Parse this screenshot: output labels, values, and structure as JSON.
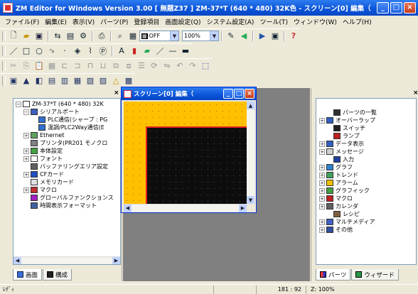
{
  "window": {
    "title": "ZM Editor for Windows Version 3.00 [ 無題Z37 ] ZM-37*T (640 * 480) 32K色 - スクリーン[0] 編集（　... ",
    "min": "_",
    "max": "□",
    "close": "×"
  },
  "menu": [
    "ファイル(F)",
    "編集(E)",
    "表示(V)",
    "パーツ(P)",
    "登録項目",
    "画面設定(Q)",
    "システム設定(A)",
    "ツール(T)",
    "ウィンドウ(W)",
    "ヘルプ(H)"
  ],
  "toolbar": {
    "grid_combo": "OFF",
    "zoom_combo": "100%"
  },
  "left_panel": {
    "close": "×",
    "tree": [
      {
        "label": "ZM-37*T (640 * 480) 32K",
        "exp": "⊟",
        "depth": 0,
        "color": "#ffffff"
      },
      {
        "label": "シリアルポート",
        "exp": "⊟",
        "depth": 1,
        "color": "#4060c0"
      },
      {
        "label": "PLC通信(シャープ : PG",
        "exp": "",
        "depth": 2,
        "color": "#3070d0"
      },
      {
        "label": "温調/PLC2Way通信(E",
        "exp": "",
        "depth": 2,
        "color": "#3070d0"
      },
      {
        "label": "Ethernet",
        "exp": "⊞",
        "depth": 1,
        "color": "#60a060"
      },
      {
        "label": "プリンタ(PR201 モノクロ",
        "exp": "",
        "depth": 1,
        "color": "#808080"
      },
      {
        "label": "本体設定",
        "exp": "⊞",
        "depth": 1,
        "color": "#40a040"
      },
      {
        "label": "フォント",
        "exp": "⊞",
        "depth": 1,
        "color": "#ffffff"
      },
      {
        "label": "バッファリングエリア設定",
        "exp": "",
        "depth": 1,
        "color": "#606060"
      },
      {
        "label": "CFカード",
        "exp": "⊞",
        "depth": 1,
        "color": "#2050c0"
      },
      {
        "label": "メモリカード",
        "exp": "",
        "depth": 1,
        "color": "#e0e0e0"
      },
      {
        "label": "マクロ",
        "exp": "⊞",
        "depth": 1,
        "color": "#c03030"
      },
      {
        "label": "グローバルファンクションス",
        "exp": "",
        "depth": 1,
        "color": "#a020c0"
      },
      {
        "label": "時間表示フォーマット",
        "exp": "",
        "depth": 1,
        "color": "#4060a0"
      }
    ],
    "tabs": [
      "画面",
      "構成"
    ]
  },
  "child_window": {
    "title": "スクリーン[0] 編集（",
    "min": "_",
    "max": "□",
    "close": "×"
  },
  "right_panel": {
    "close": "×",
    "tree": [
      {
        "label": "パーツの一覧",
        "exp": "",
        "color": "#303030"
      },
      {
        "label": "オーバーラップ",
        "exp": "⊞",
        "color": "#3060c0"
      },
      {
        "label": "スイッチ",
        "exp": "",
        "color": "#202020"
      },
      {
        "label": "ランプ",
        "exp": "",
        "color": "#c02020"
      },
      {
        "label": "データ表示",
        "exp": "⊞",
        "color": "#3060c0"
      },
      {
        "label": "メッセージ",
        "exp": "⊞",
        "color": "#d0d0d0"
      },
      {
        "label": "入力",
        "exp": "",
        "color": "#2040a0"
      },
      {
        "label": "グラフ",
        "exp": "⊞",
        "color": "#3080d0"
      },
      {
        "label": "トレンド",
        "exp": "⊞",
        "color": "#40a060"
      },
      {
        "label": "アラーム",
        "exp": "⊞",
        "color": "#f0c000"
      },
      {
        "label": "グラフィック",
        "exp": "⊞",
        "color": "#40a040"
      },
      {
        "label": "マクロ",
        "exp": "⊞",
        "color": "#c02020"
      },
      {
        "label": "カレンダ",
        "exp": "⊞",
        "color": "#606060"
      },
      {
        "label": "レシピ",
        "exp": "",
        "color": "#806040"
      },
      {
        "label": "マルチメディア",
        "exp": "⊞",
        "color": "#4060c0"
      },
      {
        "label": "その他",
        "exp": "⊞",
        "color": "#3050a0"
      }
    ],
    "tabs": [
      "パーツ",
      "ウィザード"
    ]
  },
  "status": {
    "text": "ﾚﾃﾞｨ",
    "coords": "181 : 92",
    "zoom": "Z: 100%"
  }
}
